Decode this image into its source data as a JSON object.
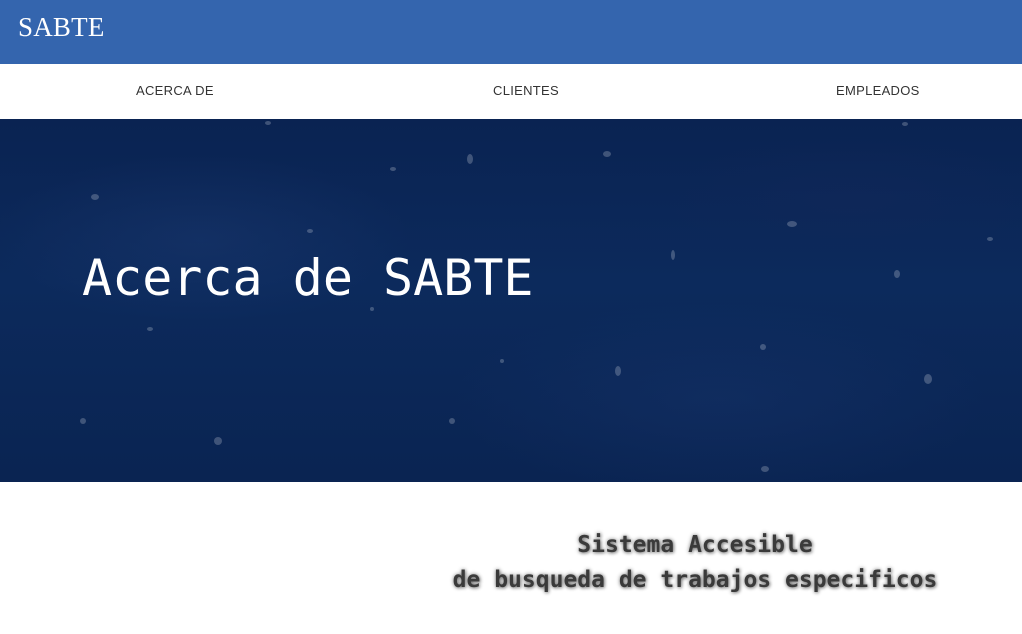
{
  "header": {
    "brand": "SABTE"
  },
  "nav": {
    "items": [
      {
        "label": "ACERCA DE"
      },
      {
        "label": "CLIENTES"
      },
      {
        "label": "EMPLEADOS"
      }
    ]
  },
  "hero": {
    "title": "Acerca de SABTE"
  },
  "tagline": {
    "line1": "Sistema Accesible",
    "line2": "de busqueda de trabajos especificos"
  },
  "colors": {
    "header_bg": "#3465ae",
    "hero_bg": "#0b2656",
    "nav_text": "#333333"
  }
}
